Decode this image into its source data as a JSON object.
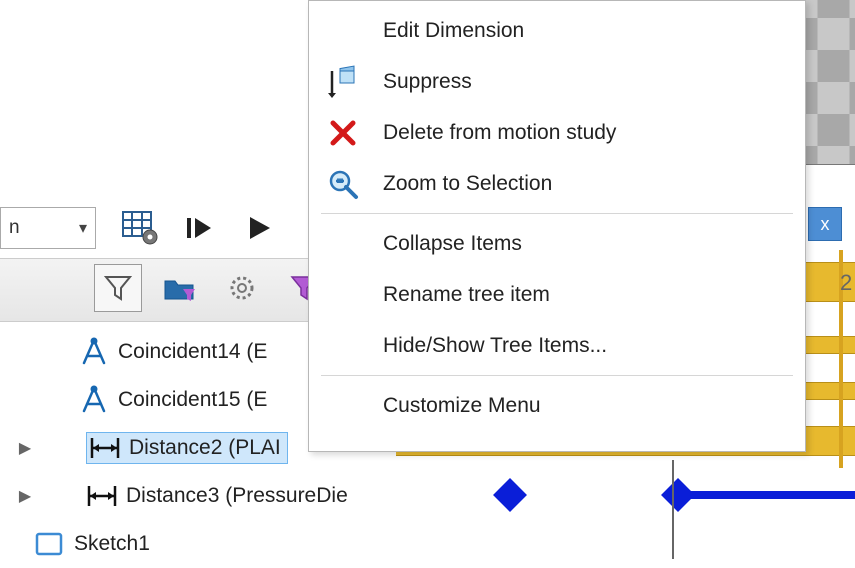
{
  "viewport": {
    "close_badge": "x"
  },
  "left_combo": {
    "text": "n",
    "chevron": "▾"
  },
  "toolbar": {
    "table_gear": "table-config",
    "step": "step-forward",
    "play": "play"
  },
  "toolbar2": {
    "filter": "filter",
    "folder_filter": "folder-filter",
    "gear": "settings",
    "filter_purple": "filter-color"
  },
  "tree": {
    "items": [
      {
        "icon": "compass",
        "label": "Coincident14 (E"
      },
      {
        "icon": "compass",
        "label": "Coincident15 (E"
      },
      {
        "icon": "distance",
        "label": "Distance2 (PLAI",
        "expandable": true,
        "selected": true
      },
      {
        "icon": "distance",
        "label": "Distance3 (PressureDie",
        "expandable": true
      },
      {
        "icon": "sketch",
        "label": "Sketch1"
      }
    ]
  },
  "context_menu": {
    "items": [
      {
        "icon": "",
        "label": "Edit Dimension"
      },
      {
        "icon": "suppress",
        "label": "Suppress"
      },
      {
        "icon": "delete",
        "label": "Delete from motion study"
      },
      {
        "icon": "zoom",
        "label": "Zoom to Selection",
        "sep_after": true
      },
      {
        "icon": "",
        "label": "Collapse Items"
      },
      {
        "icon": "",
        "label": "Rename tree item"
      },
      {
        "icon": "",
        "label": "Hide/Show Tree Items...",
        "sep_after": true
      },
      {
        "icon": "",
        "label": "Customize Menu"
      }
    ]
  },
  "timeline": {
    "header_close": "x",
    "tick_partial": "2"
  }
}
